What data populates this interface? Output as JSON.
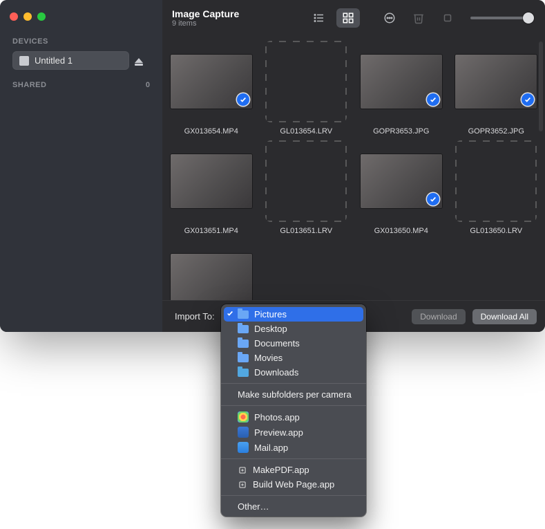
{
  "header": {
    "title": "Image Capture",
    "subtitle": "9 items"
  },
  "sidebar": {
    "devices_heading": "DEVICES",
    "device_label": "Untitled 1",
    "shared_heading": "SHARED",
    "shared_count": "0"
  },
  "grid": {
    "files": [
      {
        "name": "GX013654.MP4",
        "placeholder": false,
        "checked": true
      },
      {
        "name": "GL013654.LRV",
        "placeholder": true,
        "checked": false
      },
      {
        "name": "GOPR3653.JPG",
        "placeholder": false,
        "checked": true
      },
      {
        "name": "GOPR3652.JPG",
        "placeholder": false,
        "checked": true
      },
      {
        "name": "GX013651.MP4",
        "placeholder": false,
        "checked": false
      },
      {
        "name": "GL013651.LRV",
        "placeholder": true,
        "checked": false
      },
      {
        "name": "GX013650.MP4",
        "placeholder": false,
        "checked": true
      },
      {
        "name": "GL013650.LRV",
        "placeholder": true,
        "checked": false
      },
      {
        "name": "",
        "placeholder": false,
        "checked": false
      }
    ]
  },
  "footer": {
    "import_to_label": "Import To:",
    "download_label": "Download",
    "download_all_label": "Download All"
  },
  "menu": {
    "folders": [
      {
        "label": "Pictures",
        "selected": true
      },
      {
        "label": "Desktop",
        "selected": false
      },
      {
        "label": "Documents",
        "selected": false
      },
      {
        "label": "Movies",
        "selected": false
      },
      {
        "label": "Downloads",
        "selected": false
      }
    ],
    "subfolders_label": "Make subfolders per camera",
    "apps": [
      {
        "label": "Photos.app",
        "icon": "photos"
      },
      {
        "label": "Preview.app",
        "icon": "preview"
      },
      {
        "label": "Mail.app",
        "icon": "mail"
      }
    ],
    "actions": [
      {
        "label": "MakePDF.app"
      },
      {
        "label": "Build Web Page.app"
      }
    ],
    "other_label": "Other…"
  }
}
